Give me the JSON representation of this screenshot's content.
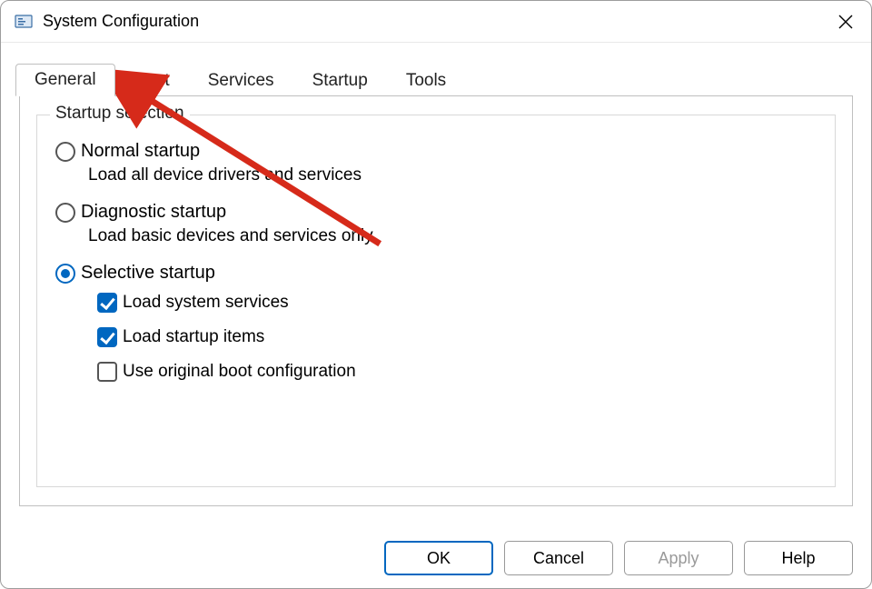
{
  "window": {
    "title": "System Configuration"
  },
  "tabs": {
    "general": "General",
    "boot": "Boot",
    "services": "Services",
    "startup": "Startup",
    "tools": "Tools",
    "active": "general"
  },
  "group": {
    "legend": "Startup selection",
    "options": {
      "normal": {
        "label": "Normal startup",
        "desc": "Load all device drivers and services",
        "selected": false
      },
      "diag": {
        "label": "Diagnostic startup",
        "desc": "Load basic devices and services only",
        "selected": false
      },
      "selective": {
        "label": "Selective startup",
        "selected": true,
        "children": {
          "loadSystem": {
            "label": "Load system services",
            "checked": true
          },
          "loadStartup": {
            "label": "Load startup items",
            "checked": true
          },
          "useOriginal": {
            "label": "Use original boot configuration",
            "checked": false
          }
        }
      }
    }
  },
  "buttons": {
    "ok": "OK",
    "cancel": "Cancel",
    "apply": "Apply",
    "help": "Help"
  },
  "annotation": {
    "arrow_target": "tab-boot",
    "color": "#d62a1a"
  }
}
